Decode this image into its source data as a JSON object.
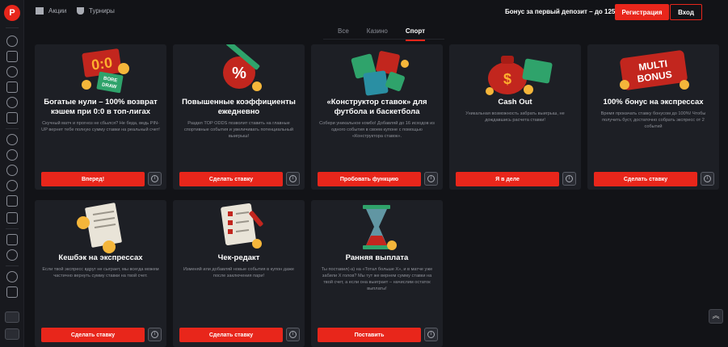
{
  "brand": {
    "logo_letter": "P"
  },
  "topbar": {
    "promotions_label": "Акции",
    "tournaments_label": "Турниры",
    "bonus_text": "Бонус за первый депозит – до 125%",
    "register_label": "Регистрация",
    "login_label": "Вход"
  },
  "tabs": [
    {
      "label": "Все",
      "active": false
    },
    {
      "label": "Казино",
      "active": false
    },
    {
      "label": "Спорт",
      "active": true
    }
  ],
  "cards": [
    {
      "title": "Богатые нули – 100% возврат кэшем при 0:0 в топ-лигах",
      "description": "Скучный матч и прогноз не сбылся? Не беда, ведь PIN-UP вернет тебе полную сумму ставки на реальный счет!",
      "button": "Вперед!",
      "art": "scoreboard-bore-draw",
      "art_text": [
        "0:0",
        "BORE",
        "DRAW"
      ]
    },
    {
      "title": "Повышенные коэффициенты ежедневно",
      "description": "Раздел TOP ODDS позволит ставить на главные спортивные события и увеличивать потенциальный выигрыш!",
      "button": "Сделать ставку",
      "art": "percent-arrow"
    },
    {
      "title": "«Конструктор ставок» для футбола и баскетбола",
      "description": "Собери уникальное комбо! Добавляй до 16 исходов из одного события в своем купоне с помощью «Конструктора ставок».",
      "button": "Пробовать функцию",
      "art": "cubes"
    },
    {
      "title": "Cash Out",
      "description": "Уникальная возможность забрать выигрыш, не дождавшись расчета ставки!",
      "button": "Я в деле",
      "art": "money-bag"
    },
    {
      "title": "100% бонус на экспрессах",
      "description": "Время прокачать ставку бонусом до 100%! Чтобы получить буст, достаточно собрать экспресс от 2 событий",
      "button": "Сделать ставку",
      "art": "multi-bonus",
      "art_text": [
        "MULTI",
        "BONUS"
      ]
    },
    {
      "title": "Кешбэк на экспрессах",
      "description": "Если твой экспресс вдруг не сыграет, мы всегда можем частично вернуть сумму ставки на твой счет.",
      "button": "Сделать ставку",
      "art": "receipt"
    },
    {
      "title": "Чек-редакт",
      "description": "Изменяй или добавляй новые события в купон даже после заключения пари!",
      "button": "Сделать ставку",
      "art": "checklist"
    },
    {
      "title": "Ранняя выплата",
      "description": "Ты поставил(-а) на «Тотал больше Х», и в матче уже забили Х голов? Мы тут же вернем сумму ставки на твой счет, а если она выиграет – начислим остаток выплаты!",
      "button": "Поставить",
      "art": "hourglass"
    }
  ],
  "scroll_top_symbol": "︽",
  "info_symbol": "i",
  "colors": {
    "accent": "#e8261b",
    "card_bg": "#1d1f25",
    "page_bg": "#121317"
  }
}
